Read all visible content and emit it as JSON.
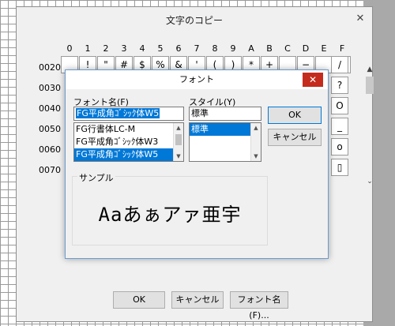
{
  "main_window": {
    "title": "文字のコピー",
    "close": "✕",
    "columns": [
      "0",
      "1",
      "2",
      "3",
      "4",
      "5",
      "6",
      "7",
      "8",
      "9",
      "A",
      "B",
      "C",
      "D",
      "E",
      "F"
    ],
    "rows": [
      "0020",
      "0030",
      "0040",
      "0050",
      "0060",
      "0070"
    ],
    "row0_chars": [
      "",
      "!",
      "\"",
      "#",
      "$",
      "%",
      "&",
      "'",
      "(",
      ")",
      "*",
      "+",
      "",
      "−",
      "",
      ""
    ],
    "side_chars": [
      "/",
      "?",
      "O",
      "_",
      "o",
      "▯"
    ],
    "buttons": {
      "ok": "OK",
      "cancel": "キャンセル",
      "font_name": "フォント名(F)..."
    },
    "scroll_up": "▲",
    "scroll_down": "⌄"
  },
  "font_dialog": {
    "title": "フォント",
    "close": "✕",
    "font_name_label": "フォント名(F)",
    "font_name_value": "FG平成角ｺﾞｼｯｸ体W5",
    "font_list": [
      "FG行書体LC-M",
      "FG平成角ｺﾞｼｯｸ体W3",
      "FG平成角ｺﾞｼｯｸ体W5"
    ],
    "font_list_selected": 2,
    "style_label": "スタイル(Y)",
    "style_value": "標準",
    "style_list": [
      "標準"
    ],
    "ok": "OK",
    "cancel": "キャンセル",
    "sample_label": "サンプル",
    "sample_text": "Aaあぁアァ亜宇",
    "scroll_up": "▲",
    "scroll_down": "▼"
  }
}
